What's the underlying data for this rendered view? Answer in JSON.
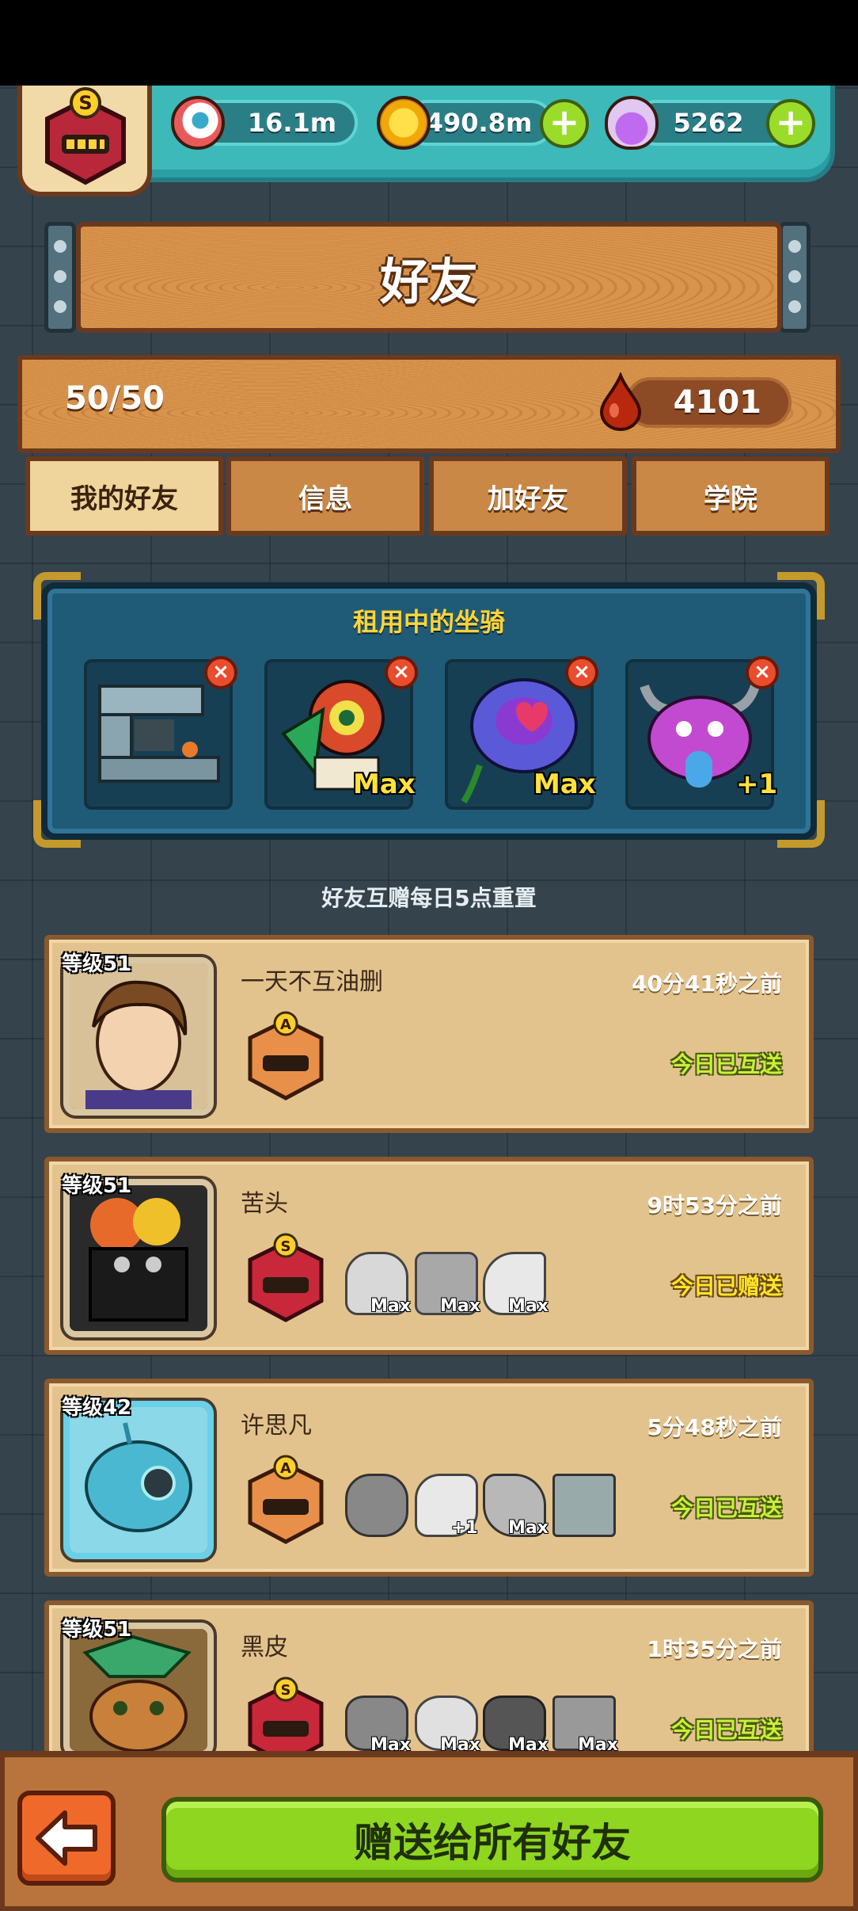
{
  "header": {
    "rank_letter": "S",
    "resources": [
      {
        "name": "eyeball",
        "value": "16.1m"
      },
      {
        "name": "gold-coin",
        "value": "490.8m"
      },
      {
        "name": "potion",
        "value": "5262"
      }
    ]
  },
  "page": {
    "title": "好友",
    "friend_count": "50/50",
    "blood_value": "4101"
  },
  "tabs": [
    {
      "label": "我的好友",
      "active": true
    },
    {
      "label": "信息",
      "active": false
    },
    {
      "label": "加好友",
      "active": false
    },
    {
      "label": "学院",
      "active": false
    }
  ],
  "mounts": {
    "title": "租用中的坐骑",
    "slots": [
      {
        "icon": "mech-mount-icon",
        "level": "",
        "color": "#8aa4b0"
      },
      {
        "icon": "dragon-mount-icon",
        "level": "Max",
        "color": "#d84a2a"
      },
      {
        "icon": "rose-mount-icon",
        "level": "Max",
        "color": "#5a5ad8"
      },
      {
        "icon": "demon-mount-icon",
        "level": "+1",
        "color": "#c24ad0"
      }
    ]
  },
  "reset_note": "好友互赠每日5点重置",
  "friends": [
    {
      "level": "等级51",
      "name": "一天不互油删",
      "last_seen": "40分41秒之前",
      "status": "今日已互送",
      "rank": "A",
      "mounts": []
    },
    {
      "level": "等级51",
      "name": "苦头",
      "last_seen": "9时53分之前",
      "status": "今日已赠送",
      "rank": "S",
      "mounts": [
        "Max",
        "Max",
        "Max"
      ]
    },
    {
      "level": "等级42",
      "name": "许思凡",
      "last_seen": "5分48秒之前",
      "status": "今日已互送",
      "rank": "A",
      "mounts": [
        "",
        "+1",
        "Max",
        ""
      ]
    },
    {
      "level": "等级51",
      "name": "黑皮",
      "last_seen": "1时35分之前",
      "status": "今日已互送",
      "rank": "S",
      "mounts": [
        "Max",
        "Max",
        "Max",
        "Max"
      ]
    }
  ],
  "footer": {
    "send_all_label": "赠送给所有好友"
  },
  "colors": {
    "wood": "#d8944c",
    "teal_bar": "#3db9b9",
    "green_button": "#8fd620",
    "status_green": "#c8f03a"
  }
}
